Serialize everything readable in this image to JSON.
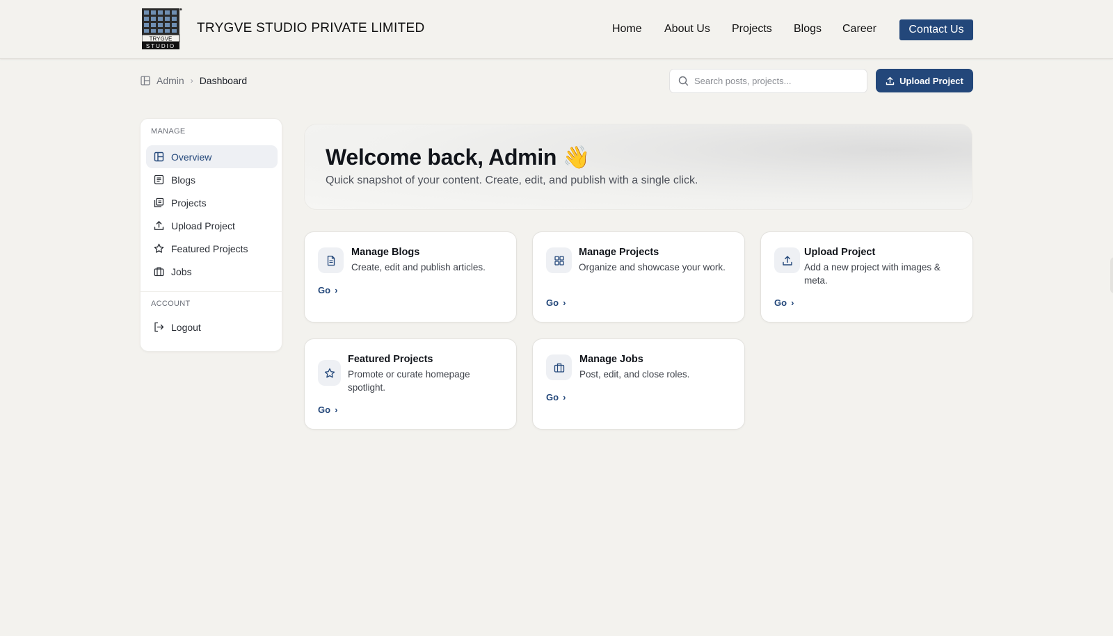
{
  "header": {
    "brand": "TRYGVE STUDIO PRIVATE LIMITED",
    "logo_text": "TRYGVE STUDIO",
    "nav": [
      "Home",
      "About Us",
      "Projects",
      "Blogs",
      "Career"
    ],
    "contact_label": "Contact Us"
  },
  "breadcrumb": {
    "root": "Admin",
    "current": "Dashboard"
  },
  "search": {
    "placeholder": "Search posts, projects..."
  },
  "upload_button": "Upload Project",
  "sidebar": {
    "manage_label": "MANAGE",
    "items": [
      {
        "label": "Overview",
        "icon": "layout-icon"
      },
      {
        "label": "Blogs",
        "icon": "list-icon"
      },
      {
        "label": "Projects",
        "icon": "gallery-icon"
      },
      {
        "label": "Upload Project",
        "icon": "upload-icon"
      },
      {
        "label": "Featured Projects",
        "icon": "star-icon"
      },
      {
        "label": "Jobs",
        "icon": "briefcase-icon"
      }
    ],
    "account_label": "ACCOUNT",
    "logout": "Logout"
  },
  "hero": {
    "title": "Welcome back, Admin",
    "emoji": "👋",
    "subtitle": "Quick snapshot of your content. Create, edit, and publish with a single click."
  },
  "cards": [
    {
      "title": "Manage Blogs",
      "desc": "Create, edit and publish articles.",
      "go": "Go",
      "icon": "document-icon"
    },
    {
      "title": "Manage Projects",
      "desc": "Organize and showcase your work.",
      "go": "Go",
      "icon": "grid-icon"
    },
    {
      "title": "Upload Project",
      "desc": "Add a new project with images & meta.",
      "go": "Go",
      "icon": "upload-icon"
    },
    {
      "title": "Featured Projects",
      "desc": "Promote or curate homepage spotlight.",
      "go": "Go",
      "icon": "star-icon"
    },
    {
      "title": "Manage Jobs",
      "desc": "Post, edit, and close roles.",
      "go": "Go",
      "icon": "briefcase-icon"
    }
  ],
  "colors": {
    "primary": "#23477a",
    "background": "#f3f2ee",
    "card": "#ffffff"
  }
}
